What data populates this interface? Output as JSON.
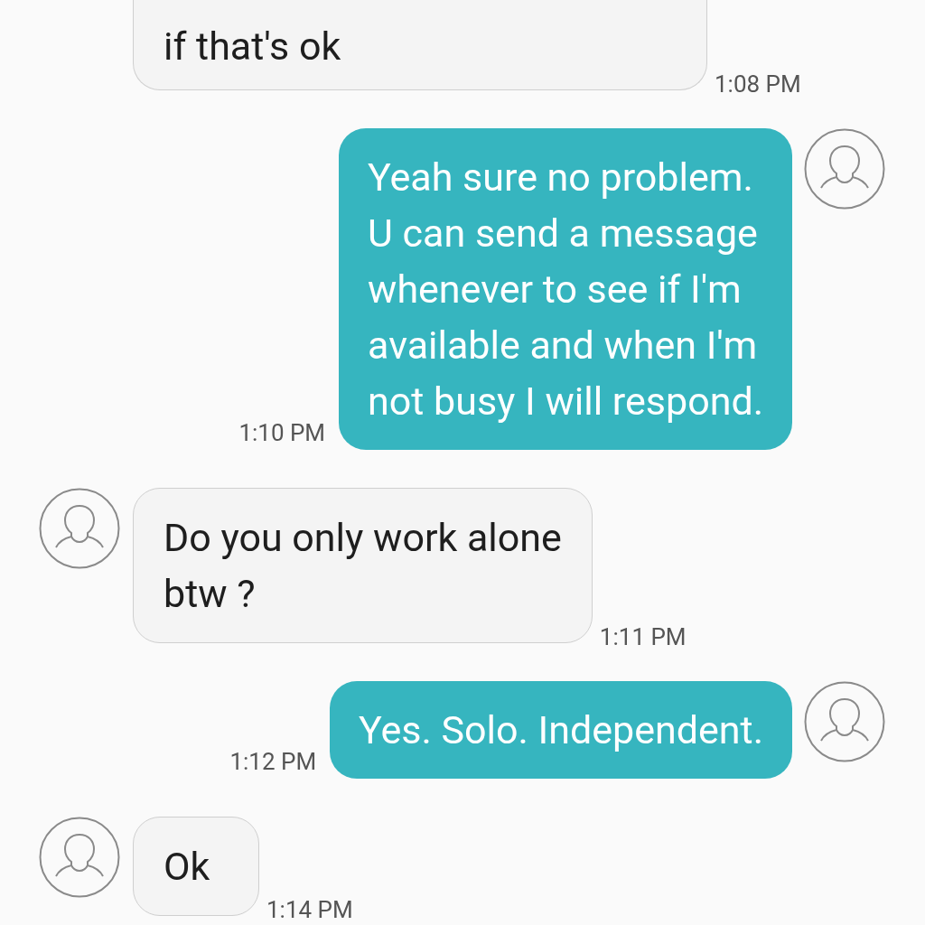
{
  "messages": [
    {
      "kind": "incoming",
      "text": "if that's ok",
      "time": "1:08 PM",
      "avatar": false
    },
    {
      "kind": "outgoing",
      "text": "Yeah sure no problem.\nU can send a message\nwhenever to see if I'm\navailable and when I'm\nnot busy I will respond.",
      "time": "1:10 PM",
      "avatar": true
    },
    {
      "kind": "incoming",
      "text": "Do you only work alone\nbtw ?",
      "time": "1:11 PM",
      "avatar": true
    },
    {
      "kind": "outgoing",
      "text": "Yes. Solo. Independent.",
      "time": "1:12 PM",
      "avatar": true
    },
    {
      "kind": "incoming",
      "text": "Ok",
      "time": "1:14 PM",
      "avatar": true
    }
  ]
}
